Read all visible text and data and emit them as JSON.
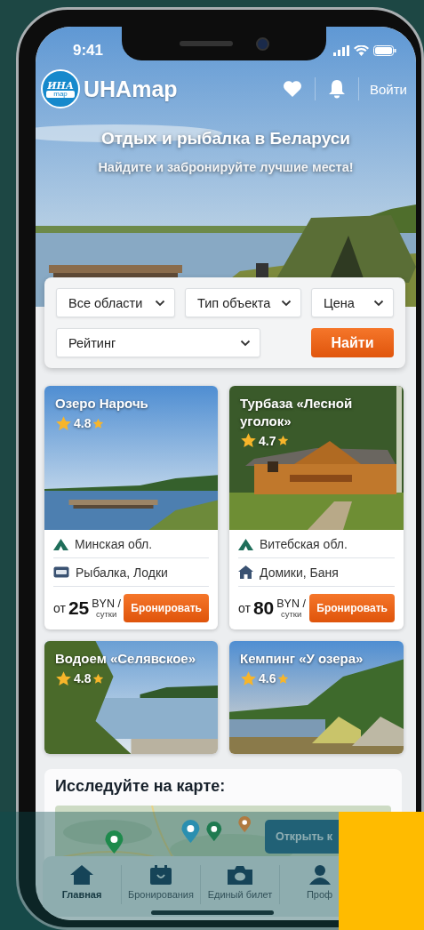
{
  "status_bar": {
    "time": "9:41"
  },
  "header": {
    "logo": {
      "title": "ИНА",
      "subtitle": "map"
    },
    "app_name": "UHAmap",
    "login": "Войти"
  },
  "hero": {
    "title": "Отдых и рыбалка в Беларуси",
    "subtitle": "Найдите и забронируйте лучшие места!"
  },
  "filters": {
    "dropdowns": [
      {
        "label": "Все области"
      },
      {
        "label": "Тип объекта"
      },
      {
        "label": "Цена"
      },
      {
        "label": "Рейтинг"
      }
    ],
    "search_button": "Найти"
  },
  "places": [
    {
      "title": "Озеро Нарочь",
      "rating": "4.8",
      "region": "Минская обл.",
      "features": "Рыбалка, Лодки",
      "price_prefix": "от",
      "price": "25",
      "currency": "BYN /",
      "unit": "сутки",
      "button": "Бронировать"
    },
    {
      "title": "Турбаза «Лесной уголок»",
      "rating": "4.7",
      "region": "Витебская обл.",
      "features": "Домики, Баня",
      "price_prefix": "от",
      "price": "80",
      "currency": "BYN /",
      "unit": "сутки",
      "button": "Бронировать"
    },
    {
      "title": "Водоем «Селявское»",
      "rating": "4.8"
    },
    {
      "title": "Кемпинг «У озера»",
      "rating": "4.6"
    }
  ],
  "map_section": {
    "title": "Исследуйте на карте:",
    "button": "Открыть к",
    "pins": [
      {
        "color": "#1e8a4c"
      },
      {
        "color": "#2a8fb0"
      },
      {
        "color": "#1f7a50"
      },
      {
        "color": "#b07a40"
      }
    ]
  },
  "tab_bar": [
    {
      "label": "Главная",
      "selected": true
    },
    {
      "label": "Бронирования",
      "selected": false
    },
    {
      "label": "Единый билет",
      "selected": false
    },
    {
      "label": "Проф",
      "selected": false
    }
  ]
}
